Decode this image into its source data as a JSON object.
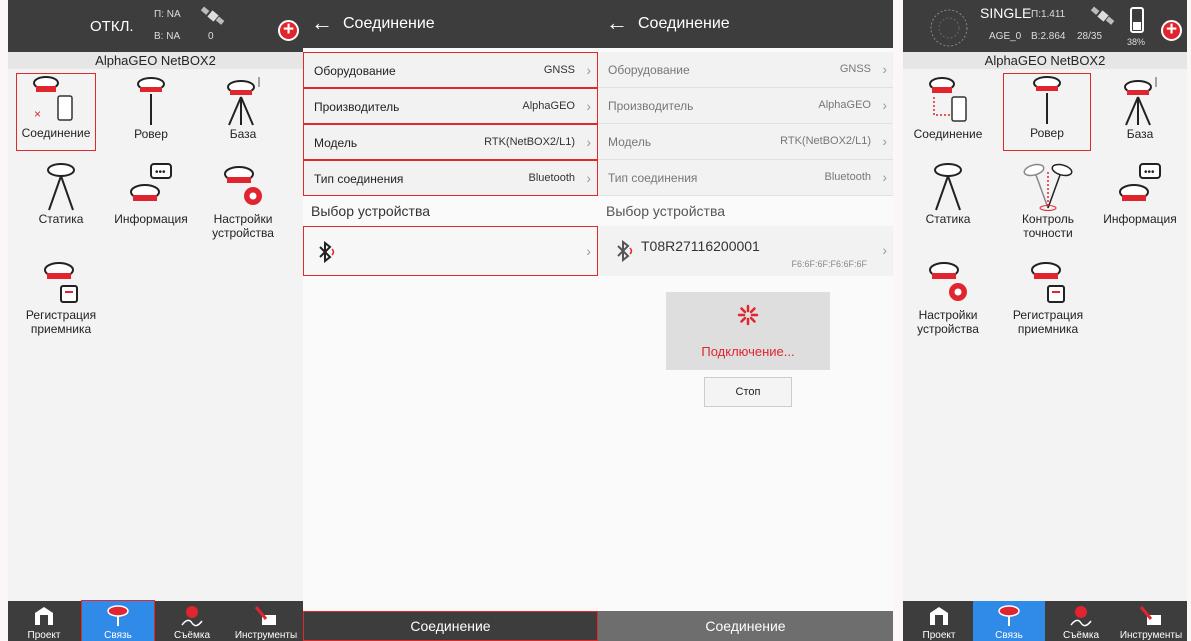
{
  "colors": {
    "accent": "#e02a2a",
    "dark": "#3d3d3d",
    "nav_active": "#2f8ae8"
  },
  "p1": {
    "status": {
      "title": "ОТКЛ.",
      "p": "П: NA",
      "b": "B: NA",
      "sats": "0"
    },
    "device_title": "AlphaGEO NetBOX2",
    "tiles": [
      "Соединение",
      "Ровер",
      "База",
      "Статика",
      "Информация",
      "Настройки устройства",
      "Регистрация приемника"
    ]
  },
  "p2": {
    "header": "Соединение",
    "rows": [
      {
        "label": "Оборудование",
        "value": "GNSS"
      },
      {
        "label": "Производитель",
        "value": "AlphaGEO"
      },
      {
        "label": "Модель",
        "value": "RTK(NetBOX2/L1)"
      },
      {
        "label": "Тип соединения",
        "value": "Bluetooth"
      }
    ],
    "section": "Выбор устройства",
    "button": "Соединение"
  },
  "p3": {
    "header": "Соединение",
    "rows": [
      {
        "label": "Оборудование",
        "value": "GNSS"
      },
      {
        "label": "Производитель",
        "value": "AlphaGEO"
      },
      {
        "label": "Модель",
        "value": "RTK(NetBOX2/L1)"
      },
      {
        "label": "Тип соединения",
        "value": "Bluetooth"
      }
    ],
    "section": "Выбор устройства",
    "device": {
      "name": "T08R27116200001",
      "mac": "F6:6F:6F:F6:6F:6F"
    },
    "connecting": "Подключение...",
    "stop": "Стоп",
    "button": "Соединение"
  },
  "p4": {
    "status": {
      "title": "SINGLE",
      "p": "П:1.411",
      "age": "AGE_0",
      "b": "B:2.864",
      "sats": "28/35",
      "battery": "38%"
    },
    "device_title": "AlphaGEO NetBOX2",
    "tiles": [
      "Соединение",
      "Ровер",
      "База",
      "Статика",
      "Контроль точности",
      "Информация",
      "Настройки устройства",
      "Регистрация приемника"
    ]
  },
  "nav": [
    "Проект",
    "Связь",
    "Съёмка",
    "Инструменты"
  ]
}
